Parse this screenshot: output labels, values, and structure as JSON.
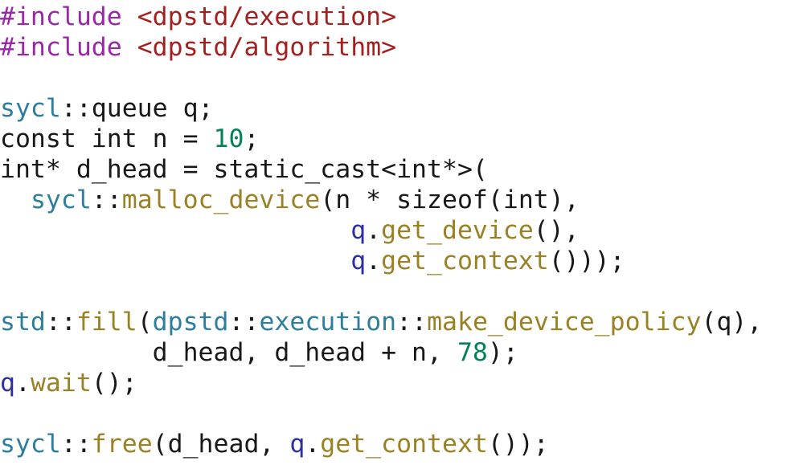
{
  "document": {
    "kind": "source-code-listing",
    "language": "C++",
    "background_color": "#ffffff"
  },
  "palette": {
    "preprocessor": "#9a27a8",
    "header_string": "#a32020",
    "namespace": "#2c7d9e",
    "function": "#9a8124",
    "number": "#04805c",
    "variable": "#2d2da6",
    "plain": "#181818"
  },
  "code": {
    "lines": [
      {
        "index": 1,
        "text": "#include <dpstd/execution>",
        "tokens": [
          {
            "t": "#include",
            "c": "tok-pp"
          },
          {
            "t": " ",
            "c": "tok-plain"
          },
          {
            "t": "<dpstd/execution>",
            "c": "tok-header"
          }
        ]
      },
      {
        "index": 2,
        "text": "#include <dpstd/algorithm>",
        "tokens": [
          {
            "t": "#include",
            "c": "tok-pp"
          },
          {
            "t": " ",
            "c": "tok-plain"
          },
          {
            "t": "<dpstd/algorithm>",
            "c": "tok-header"
          }
        ]
      },
      {
        "index": 3,
        "text": "",
        "tokens": []
      },
      {
        "index": 4,
        "text": "sycl::queue q;",
        "tokens": [
          {
            "t": "sycl",
            "c": "tok-ns"
          },
          {
            "t": "::queue q;",
            "c": "tok-plain"
          }
        ]
      },
      {
        "index": 5,
        "text": "const int n = 10;",
        "tokens": [
          {
            "t": "const int n = ",
            "c": "tok-plain"
          },
          {
            "t": "10",
            "c": "tok-num"
          },
          {
            "t": ";",
            "c": "tok-plain"
          }
        ]
      },
      {
        "index": 6,
        "text": "int* d_head = static_cast<int*>(",
        "tokens": [
          {
            "t": "int* d_head = static_cast<int*>(",
            "c": "tok-plain"
          }
        ]
      },
      {
        "index": 7,
        "text": "  sycl::malloc_device(n * sizeof(int),",
        "tokens": [
          {
            "t": "  ",
            "c": "tok-plain"
          },
          {
            "t": "sycl",
            "c": "tok-ns"
          },
          {
            "t": "::",
            "c": "tok-plain"
          },
          {
            "t": "malloc_device",
            "c": "tok-fn"
          },
          {
            "t": "(n * sizeof(int),",
            "c": "tok-plain"
          }
        ]
      },
      {
        "index": 8,
        "text": "                       q.get_device(),",
        "tokens": [
          {
            "t": "                       ",
            "c": "tok-plain"
          },
          {
            "t": "q",
            "c": "tok-var"
          },
          {
            "t": ".",
            "c": "tok-plain"
          },
          {
            "t": "get_device",
            "c": "tok-fn"
          },
          {
            "t": "(),",
            "c": "tok-plain"
          }
        ]
      },
      {
        "index": 9,
        "text": "                       q.get_context()));",
        "tokens": [
          {
            "t": "                       ",
            "c": "tok-plain"
          },
          {
            "t": "q",
            "c": "tok-var"
          },
          {
            "t": ".",
            "c": "tok-plain"
          },
          {
            "t": "get_context",
            "c": "tok-fn"
          },
          {
            "t": "()));",
            "c": "tok-plain"
          }
        ]
      },
      {
        "index": 10,
        "text": "",
        "tokens": []
      },
      {
        "index": 11,
        "text": "std::fill(dpstd::execution::make_device_policy(q),",
        "tokens": [
          {
            "t": "std",
            "c": "tok-ns"
          },
          {
            "t": "::",
            "c": "tok-plain"
          },
          {
            "t": "fill",
            "c": "tok-fn"
          },
          {
            "t": "(",
            "c": "tok-plain"
          },
          {
            "t": "dpstd",
            "c": "tok-ns"
          },
          {
            "t": "::",
            "c": "tok-plain"
          },
          {
            "t": "execution",
            "c": "tok-ns"
          },
          {
            "t": "::",
            "c": "tok-plain"
          },
          {
            "t": "make_device_policy",
            "c": "tok-fn"
          },
          {
            "t": "(q),",
            "c": "tok-plain"
          }
        ]
      },
      {
        "index": 12,
        "text": "          d_head, d_head + n, 78);",
        "tokens": [
          {
            "t": "          d_head, d_head + n, ",
            "c": "tok-plain"
          },
          {
            "t": "78",
            "c": "tok-num"
          },
          {
            "t": ");",
            "c": "tok-plain"
          }
        ]
      },
      {
        "index": 13,
        "text": "q.wait();",
        "tokens": [
          {
            "t": "q",
            "c": "tok-var"
          },
          {
            "t": ".",
            "c": "tok-plain"
          },
          {
            "t": "wait",
            "c": "tok-fn"
          },
          {
            "t": "();",
            "c": "tok-plain"
          }
        ]
      },
      {
        "index": 14,
        "text": "",
        "tokens": []
      },
      {
        "index": 15,
        "text": "sycl::free(d_head, q.get_context());",
        "tokens": [
          {
            "t": "sycl",
            "c": "tok-ns"
          },
          {
            "t": "::",
            "c": "tok-plain"
          },
          {
            "t": "free",
            "c": "tok-fn"
          },
          {
            "t": "(d_head, ",
            "c": "tok-plain"
          },
          {
            "t": "q",
            "c": "tok-var"
          },
          {
            "t": ".",
            "c": "tok-plain"
          },
          {
            "t": "get_context",
            "c": "tok-fn"
          },
          {
            "t": "());",
            "c": "tok-plain"
          }
        ]
      }
    ]
  }
}
